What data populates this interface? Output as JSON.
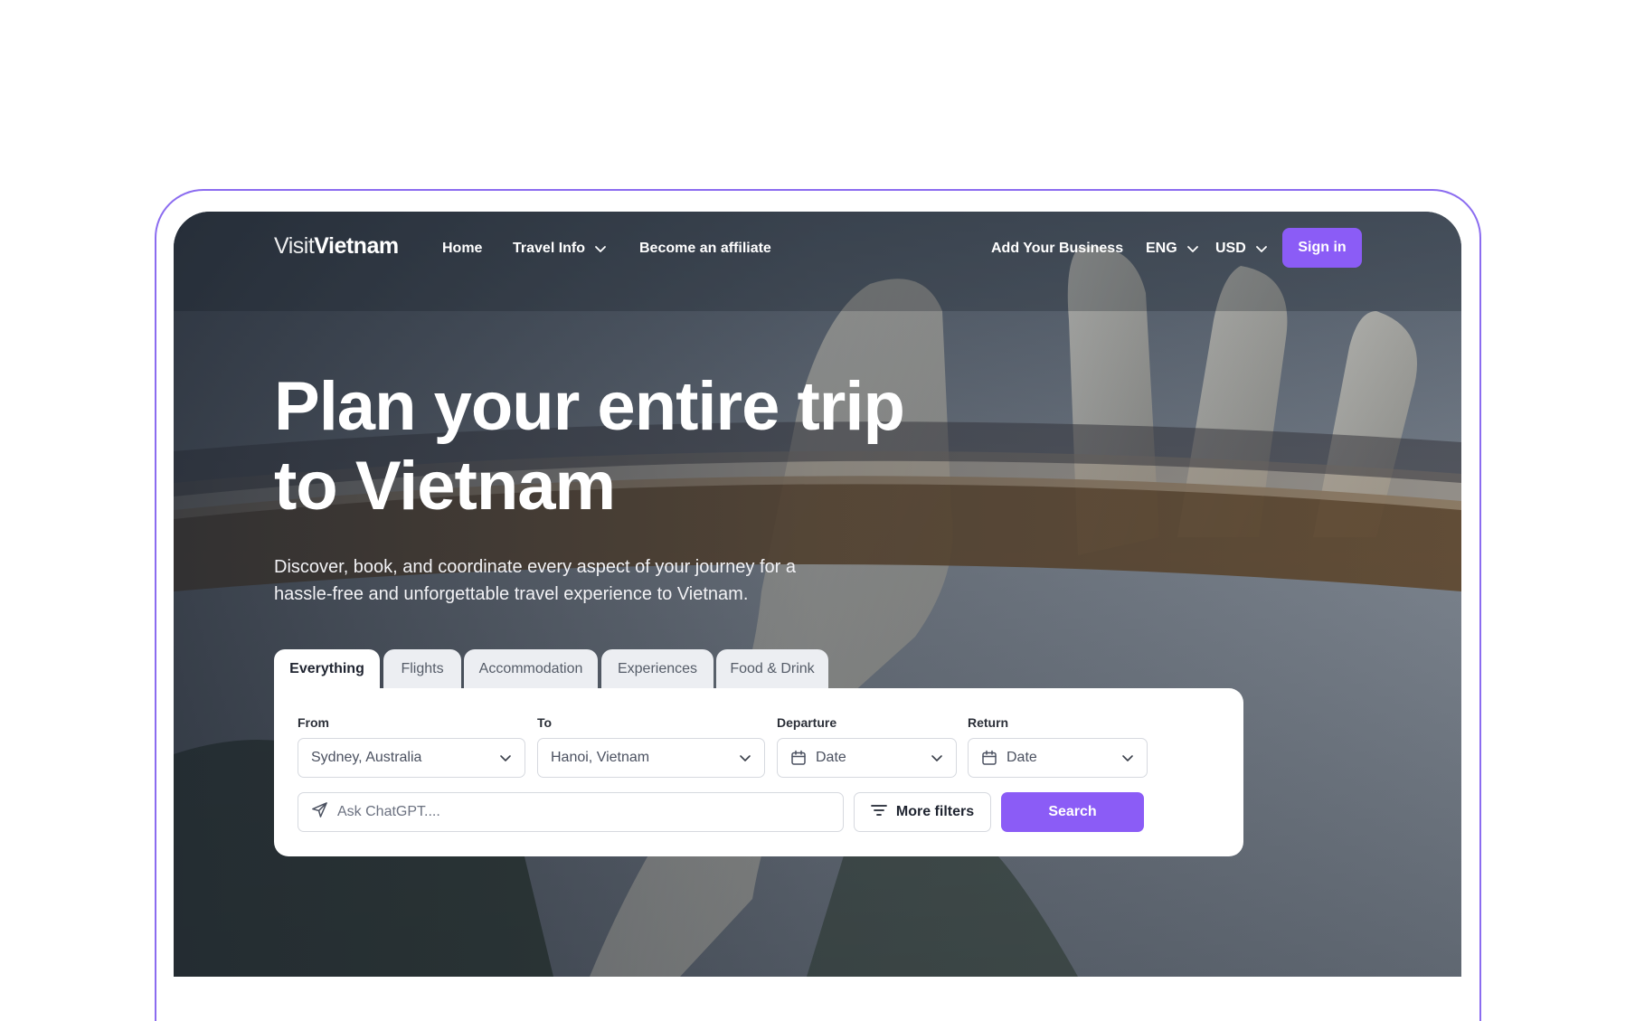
{
  "brand": {
    "logo_part1": "Visit",
    "logo_part2": "Vietnam",
    "accent": "#8b5cf6"
  },
  "nav": {
    "home": "Home",
    "travel_info": "Travel Info",
    "affiliate": "Become an affiliate",
    "add_business": "Add Your Business",
    "language": "ENG",
    "currency": "USD",
    "sign_in": "Sign in"
  },
  "hero": {
    "title_line1": "Plan your entire trip",
    "title_line2": "to Vietnam",
    "subtitle_line1": "Discover, book, and coordinate every aspect of your journey for a",
    "subtitle_line2": "hassle-free and unforgettable travel experience to Vietnam."
  },
  "tabs": [
    "Everything",
    "Flights",
    "Accommodation",
    "Experiences",
    "Food & Drink"
  ],
  "active_tab": "Everything",
  "search": {
    "from_label": "From",
    "from_value": "Sydney, Australia",
    "to_label": "To",
    "to_value": "Hanoi, Vietnam",
    "departure_label": "Departure",
    "departure_value": "Date",
    "return_label": "Return",
    "return_value": "Date",
    "ask_placeholder": "Ask ChatGPT....",
    "more_filters": "More filters",
    "search_button": "Search"
  },
  "icons": {
    "dropdown": "chevron-down-icon",
    "calendar": "calendar-icon",
    "send": "send-icon",
    "filter": "filter-icon"
  }
}
